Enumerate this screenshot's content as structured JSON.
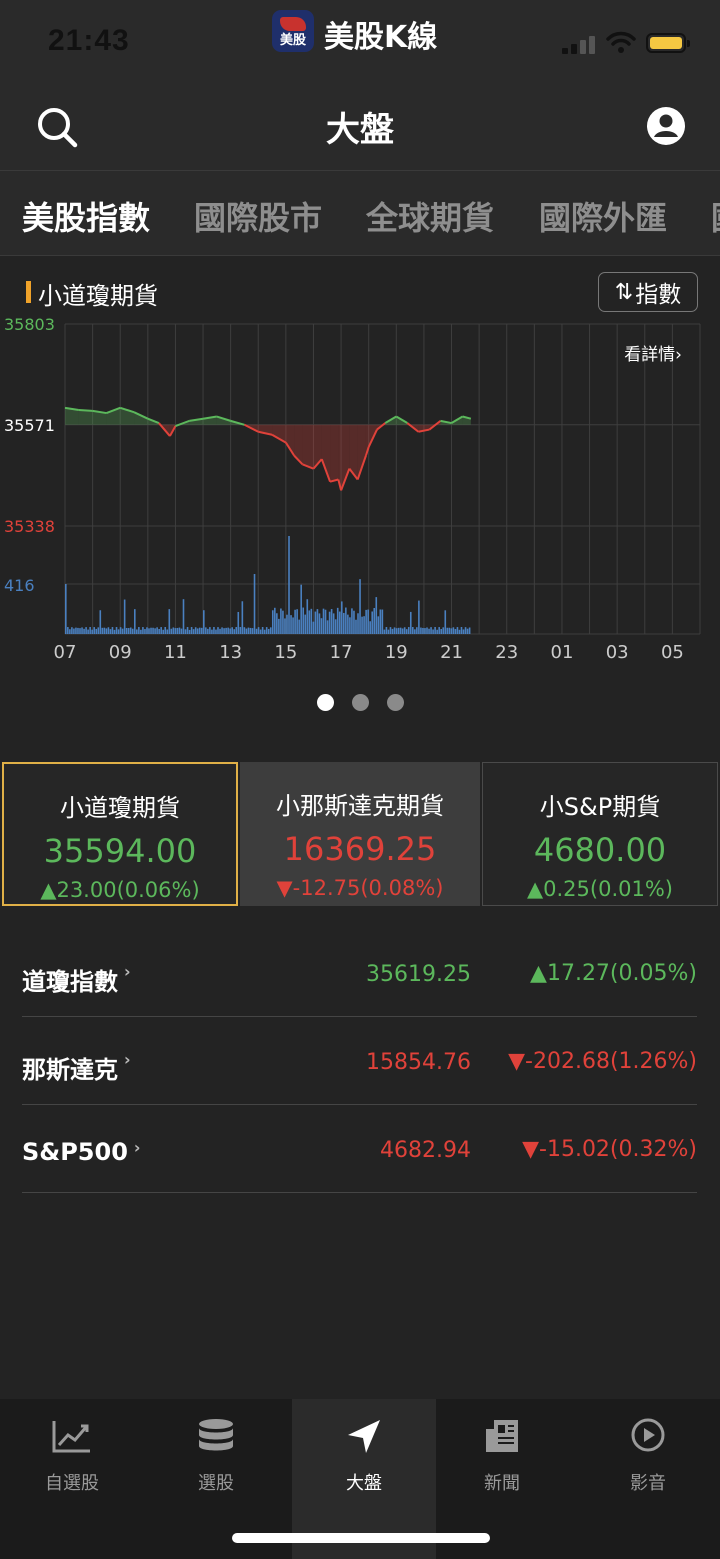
{
  "status_bar": {
    "time": "21:43",
    "app_name": "美股K線",
    "app_icon_text": "美股"
  },
  "header": {
    "title": "大盤",
    "left_icon": "search-icon",
    "right_icon": "account-icon"
  },
  "tabs": [
    {
      "label": "美股指數",
      "active": true
    },
    {
      "label": "國際股市",
      "active": false
    },
    {
      "label": "全球期貨",
      "active": false
    },
    {
      "label": "國際外匯",
      "active": false
    },
    {
      "label": "國",
      "active": false
    }
  ],
  "chart_section": {
    "title": "小道瓊期貨",
    "toggle_label": "指數",
    "detail_link": "看詳情",
    "accent_color": "#f0a32a"
  },
  "chart_data": {
    "type": "line",
    "y_labels": {
      "high": "35803",
      "base": "35571",
      "low": "35338",
      "volume": "416"
    },
    "ylim": [
      35338,
      35803
    ],
    "baseline": 35571,
    "x_ticks": [
      "07",
      "09",
      "11",
      "13",
      "15",
      "17",
      "19",
      "21",
      "23",
      "01",
      "03",
      "05"
    ],
    "series": [
      {
        "x": [
          7,
          7.5,
          8,
          8.5,
          9,
          9.5,
          10,
          10.4,
          10.8,
          11,
          11.5,
          12,
          12.5,
          13,
          13.5,
          14,
          14.5,
          15,
          15.3,
          15.6,
          16,
          16.3,
          16.6,
          16.9,
          17,
          17.3,
          17.6,
          17.9,
          18,
          18.3,
          18.6,
          19,
          19.4,
          19.8,
          20.2,
          20.6,
          21,
          21.4,
          21.7
        ],
        "values": [
          35610,
          35605,
          35603,
          35598,
          35610,
          35600,
          35585,
          35575,
          35545,
          35568,
          35580,
          35585,
          35590,
          35580,
          35571,
          35555,
          35548,
          35530,
          35500,
          35480,
          35470,
          35492,
          35440,
          35445,
          35420,
          35470,
          35445,
          35500,
          35520,
          35560,
          35575,
          35590,
          35575,
          35555,
          35560,
          35580,
          35575,
          35590,
          35585
        ]
      }
    ],
    "volume_peak": 416,
    "colors": {
      "up": "#5cb85c",
      "down": "#e0423a",
      "volume": "#4a80c0"
    },
    "grid": true
  },
  "pager": {
    "count": 3,
    "active": 0
  },
  "futures_cards": [
    {
      "name": "小道瓊期貨",
      "price": "35594.00",
      "change": "▲23.00(0.06%)",
      "direction": "up",
      "selected": true
    },
    {
      "name": "小那斯達克期貨",
      "price": "16369.25",
      "change": "▼-12.75(0.08%)",
      "direction": "down",
      "selected": false
    },
    {
      "name": "小S&P期貨",
      "price": "4680.00",
      "change": "▲0.25(0.01%)",
      "direction": "up",
      "selected": false
    }
  ],
  "indices": [
    {
      "name": "道瓊指數",
      "value": "35619.25",
      "change": "▲17.27(0.05%)",
      "direction": "up"
    },
    {
      "name": "那斯達克",
      "value": "15854.76",
      "change": "▼-202.68(1.26%)",
      "direction": "down"
    },
    {
      "name": "S&P500",
      "value": "4682.94",
      "change": "▼-15.02(0.32%)",
      "direction": "down"
    }
  ],
  "bottom_tabs": [
    {
      "label": "自選股",
      "icon": "line-chart-icon",
      "active": false
    },
    {
      "label": "選股",
      "icon": "database-icon",
      "active": false
    },
    {
      "label": "大盤",
      "icon": "navigation-arrow-icon",
      "active": true
    },
    {
      "label": "新聞",
      "icon": "newspaper-icon",
      "active": false
    },
    {
      "label": "影音",
      "icon": "play-circle-icon",
      "active": false
    }
  ]
}
